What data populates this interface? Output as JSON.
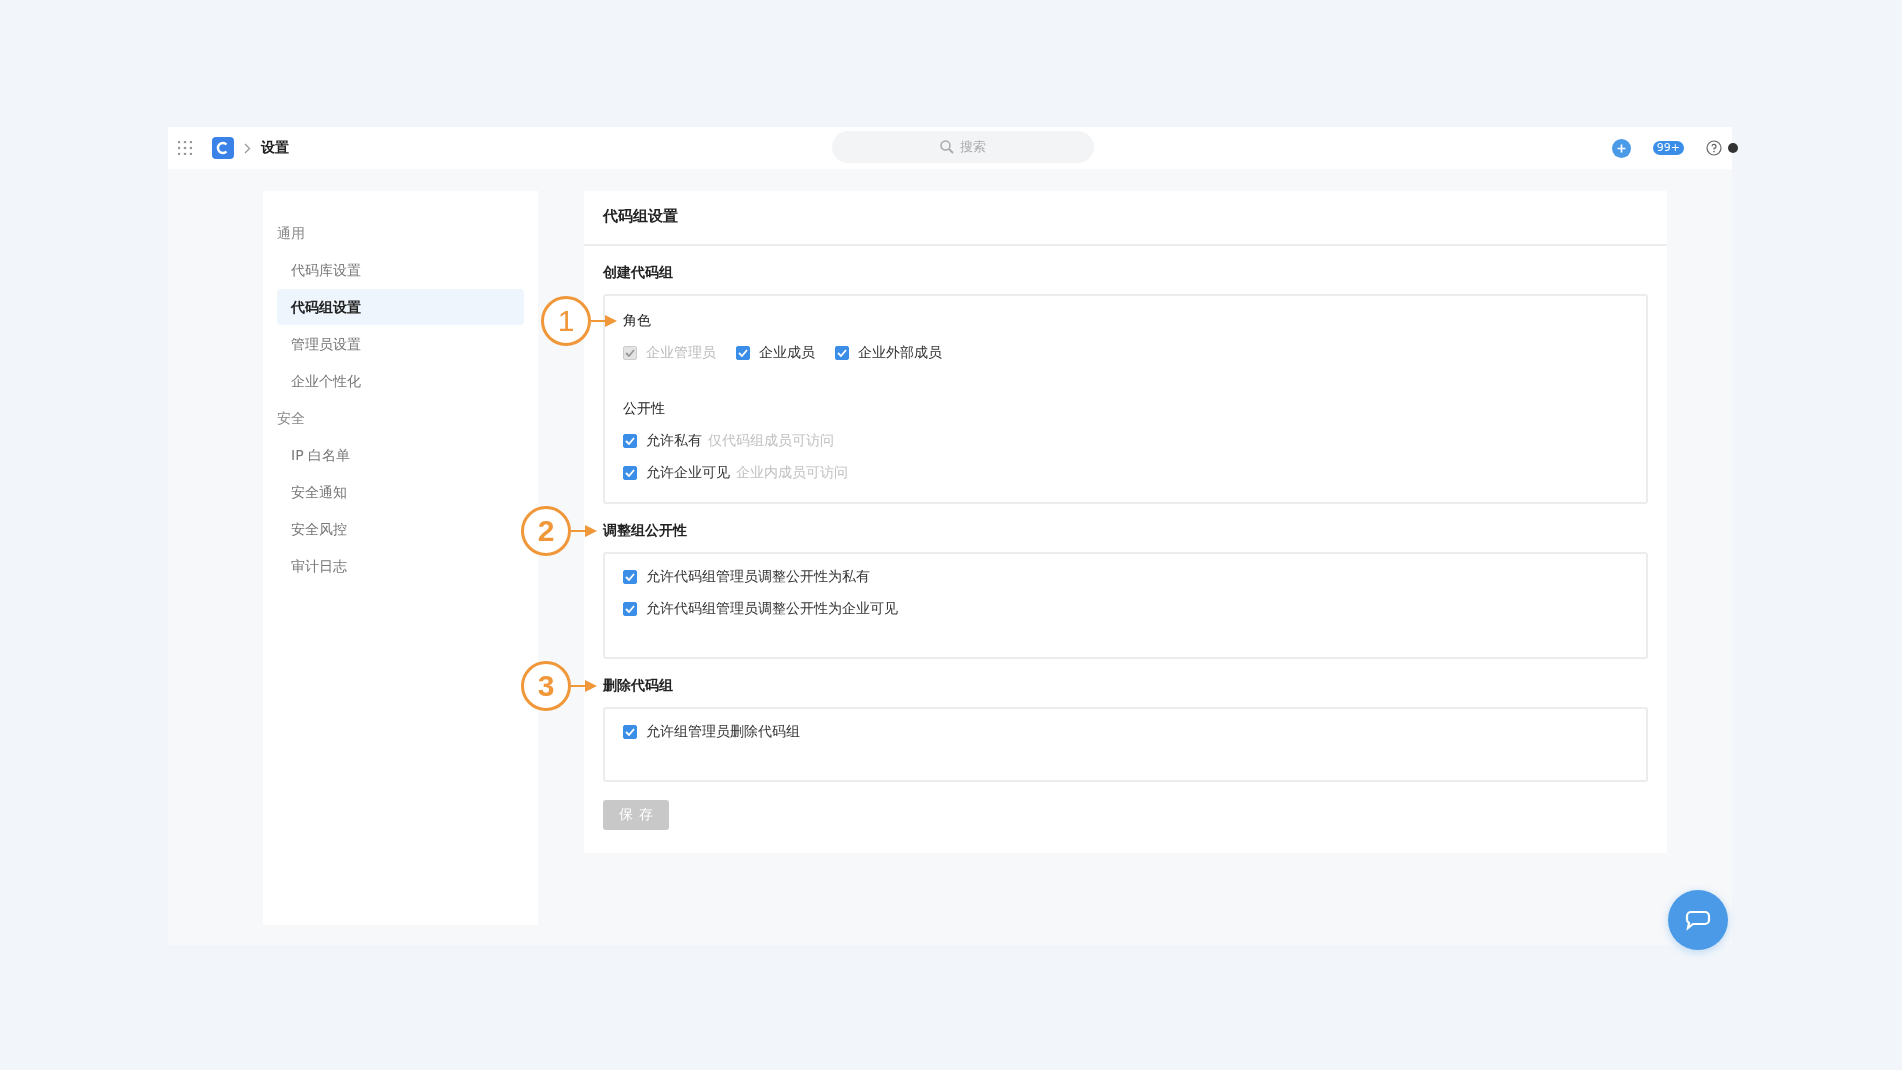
{
  "topbar": {
    "breadcrumb": "设置",
    "search": {
      "placeholder": "搜索"
    },
    "notification_badge": "99+"
  },
  "sidebar": {
    "groups": [
      {
        "label": "通用",
        "items": [
          {
            "label": "代码库设置",
            "selected": false
          },
          {
            "label": "代码组设置",
            "selected": true
          },
          {
            "label": "管理员设置",
            "selected": false
          },
          {
            "label": "企业个性化",
            "selected": false
          }
        ]
      },
      {
        "label": "安全",
        "items": [
          {
            "label": "IP 白名单",
            "selected": false
          },
          {
            "label": "安全通知",
            "selected": false
          },
          {
            "label": "安全风控",
            "selected": false
          },
          {
            "label": "审计日志",
            "selected": false
          }
        ]
      }
    ]
  },
  "page": {
    "title": "代码组设置",
    "sections": [
      {
        "title": "创建代码组",
        "groups": [
          {
            "label": "角色",
            "kind": "row",
            "annotation": "1",
            "options": [
              {
                "label": "企业管理员",
                "checked": true,
                "disabled": true
              },
              {
                "label": "企业成员",
                "checked": true,
                "disabled": false
              },
              {
                "label": "企业外部成员",
                "checked": true,
                "disabled": false
              }
            ]
          },
          {
            "label": "公开性",
            "kind": "column",
            "options": [
              {
                "label": "允许私有",
                "hint": "仅代码组成员可访问",
                "checked": true,
                "disabled": false
              },
              {
                "label": "允许企业可见",
                "hint": "企业内成员可访问",
                "checked": true,
                "disabled": false
              }
            ]
          }
        ]
      },
      {
        "title": "调整组公开性",
        "annotation": "2",
        "groups": [
          {
            "kind": "column",
            "options": [
              {
                "label": "允许代码组管理员调整公开性为私有",
                "checked": true,
                "disabled": false
              },
              {
                "label": "允许代码组管理员调整公开性为企业可见",
                "checked": true,
                "disabled": false
              }
            ]
          }
        ]
      },
      {
        "title": "删除代码组",
        "annotation": "3",
        "groups": [
          {
            "kind": "column",
            "options": [
              {
                "label": "允许组管理员删除代码组",
                "checked": true,
                "disabled": false
              }
            ]
          }
        ]
      }
    ],
    "save_button": {
      "label": "保存",
      "disabled": true
    }
  }
}
